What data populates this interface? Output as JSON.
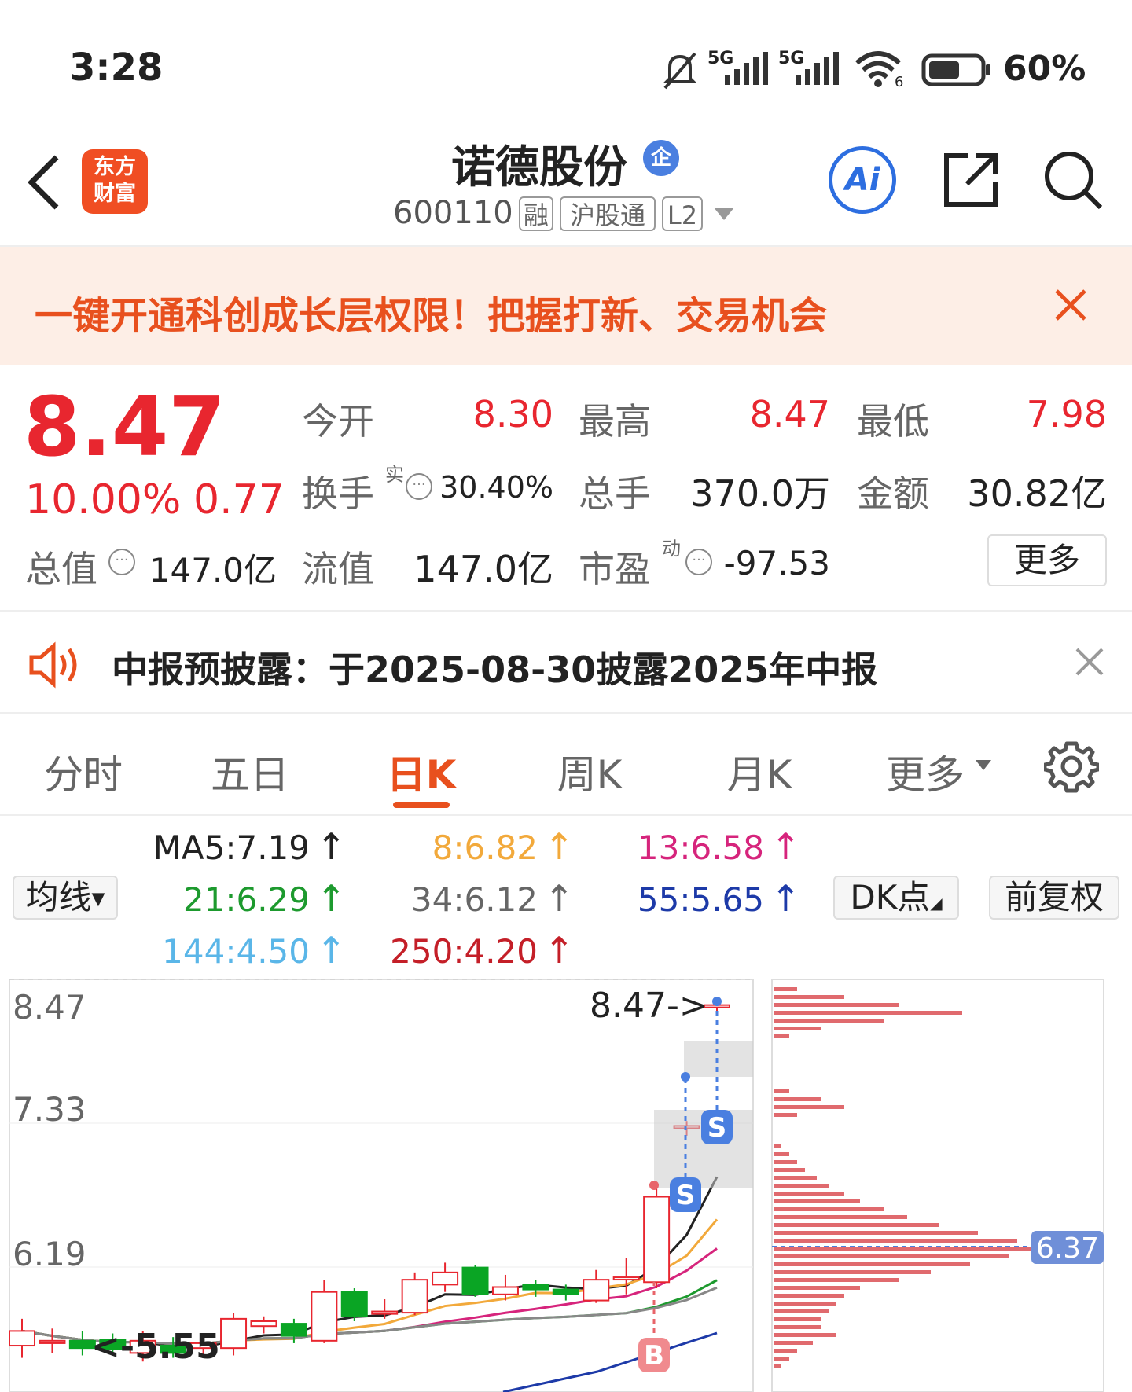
{
  "status_bar": {
    "time": "3:28",
    "net1": "5G",
    "net2": "5G",
    "wifi_sub": "6",
    "battery": "60%"
  },
  "header": {
    "logo_line1": "东方",
    "logo_line2": "财富",
    "title": "诺德股份",
    "title_badge": "企",
    "code": "600110",
    "tags": [
      "融",
      "沪股通",
      "L2"
    ],
    "ai_label": "Ai"
  },
  "promo": {
    "text": "一键开通科创成长层权限！把握打新、交易机会"
  },
  "quote": {
    "price": "8.47",
    "change_pct": "10.00%",
    "change": "0.77",
    "open_label": "今开",
    "open": "8.30",
    "high_label": "最高",
    "high": "8.47",
    "low_label": "最低",
    "low": "7.98",
    "turnover_label": "换手",
    "turnover_sup": "实",
    "turnover": "30.40%",
    "volume_label": "总手",
    "volume": "370.0万",
    "amount_label": "金额",
    "amount": "30.82亿",
    "mktcap_label": "总值",
    "mktcap": "147.0亿",
    "float_label": "流值",
    "float": "147.0亿",
    "pe_label": "市盈",
    "pe_sup": "动",
    "pe": "-97.53",
    "more_label": "更多"
  },
  "notice": {
    "text": "中报预披露：于2025-08-30披露2025年中报"
  },
  "tabs": {
    "t0": "分时",
    "t1": "五日",
    "t2": "日K",
    "t3": "周K",
    "t4": "月K",
    "t5": "更多"
  },
  "ma": {
    "ma5": "MA5:7.19",
    "ma8": "8:6.82",
    "ma13": "13:6.58",
    "ma21": "21:6.29",
    "ma34": "34:6.12",
    "ma55": "55:5.65",
    "ma144": "144:4.50",
    "ma250": "250:4.20",
    "arrow": "↑"
  },
  "controls": {
    "avg_line": "均线",
    "dk": "DK点",
    "fq": "前复权"
  },
  "chart_data": {
    "type": "candlestick",
    "y_ticks": [
      "8.47",
      "7.33",
      "6.19"
    ],
    "annotations": {
      "high_marker": "8.47->",
      "low_marker": "<-5.55",
      "volume_profile_price": "6.37"
    },
    "signals": [
      "S",
      "S",
      "B"
    ],
    "ylim": [
      5.5,
      8.5
    ],
    "candles": [
      {
        "o": 5.68,
        "c": 5.8,
        "h": 5.9,
        "l": 5.58
      },
      {
        "o": 5.7,
        "c": 5.72,
        "h": 5.82,
        "l": 5.62
      },
      {
        "o": 5.72,
        "c": 5.66,
        "h": 5.8,
        "l": 5.6
      },
      {
        "o": 5.73,
        "c": 5.65,
        "h": 5.78,
        "l": 5.6
      },
      {
        "o": 5.62,
        "c": 5.72,
        "h": 5.8,
        "l": 5.55
      },
      {
        "o": 5.68,
        "c": 5.62,
        "h": 5.75,
        "l": 5.58
      },
      {
        "o": 5.66,
        "c": 5.7,
        "h": 5.78,
        "l": 5.6
      },
      {
        "o": 5.66,
        "c": 5.9,
        "h": 5.95,
        "l": 5.6
      },
      {
        "o": 5.84,
        "c": 5.88,
        "h": 5.92,
        "l": 5.78
      },
      {
        "o": 5.86,
        "c": 5.76,
        "h": 5.9,
        "l": 5.7
      },
      {
        "o": 5.72,
        "c": 6.12,
        "h": 6.22,
        "l": 5.7
      },
      {
        "o": 6.12,
        "c": 5.92,
        "h": 6.15,
        "l": 5.88
      },
      {
        "o": 5.94,
        "c": 5.96,
        "h": 6.06,
        "l": 5.9
      },
      {
        "o": 5.95,
        "c": 6.22,
        "h": 6.28,
        "l": 5.93
      },
      {
        "o": 6.18,
        "c": 6.28,
        "h": 6.36,
        "l": 6.12
      },
      {
        "o": 6.32,
        "c": 6.1,
        "h": 6.34,
        "l": 6.08
      },
      {
        "o": 6.1,
        "c": 6.16,
        "h": 6.26,
        "l": 6.05
      },
      {
        "o": 6.18,
        "c": 6.14,
        "h": 6.22,
        "l": 6.08
      },
      {
        "o": 6.14,
        "c": 6.1,
        "h": 6.18,
        "l": 6.05
      },
      {
        "o": 6.05,
        "c": 6.22,
        "h": 6.3,
        "l": 6.03
      },
      {
        "o": 6.24,
        "c": 6.24,
        "h": 6.4,
        "l": 6.1
      },
      {
        "o": 6.2,
        "c": 6.9,
        "h": 7.0,
        "l": 6.15
      },
      {
        "o": 7.48,
        "c": 7.48,
        "h": 7.52,
        "l": 7.4
      },
      {
        "o": 8.47,
        "c": 8.47,
        "h": 8.47,
        "l": 8.38
      }
    ]
  }
}
